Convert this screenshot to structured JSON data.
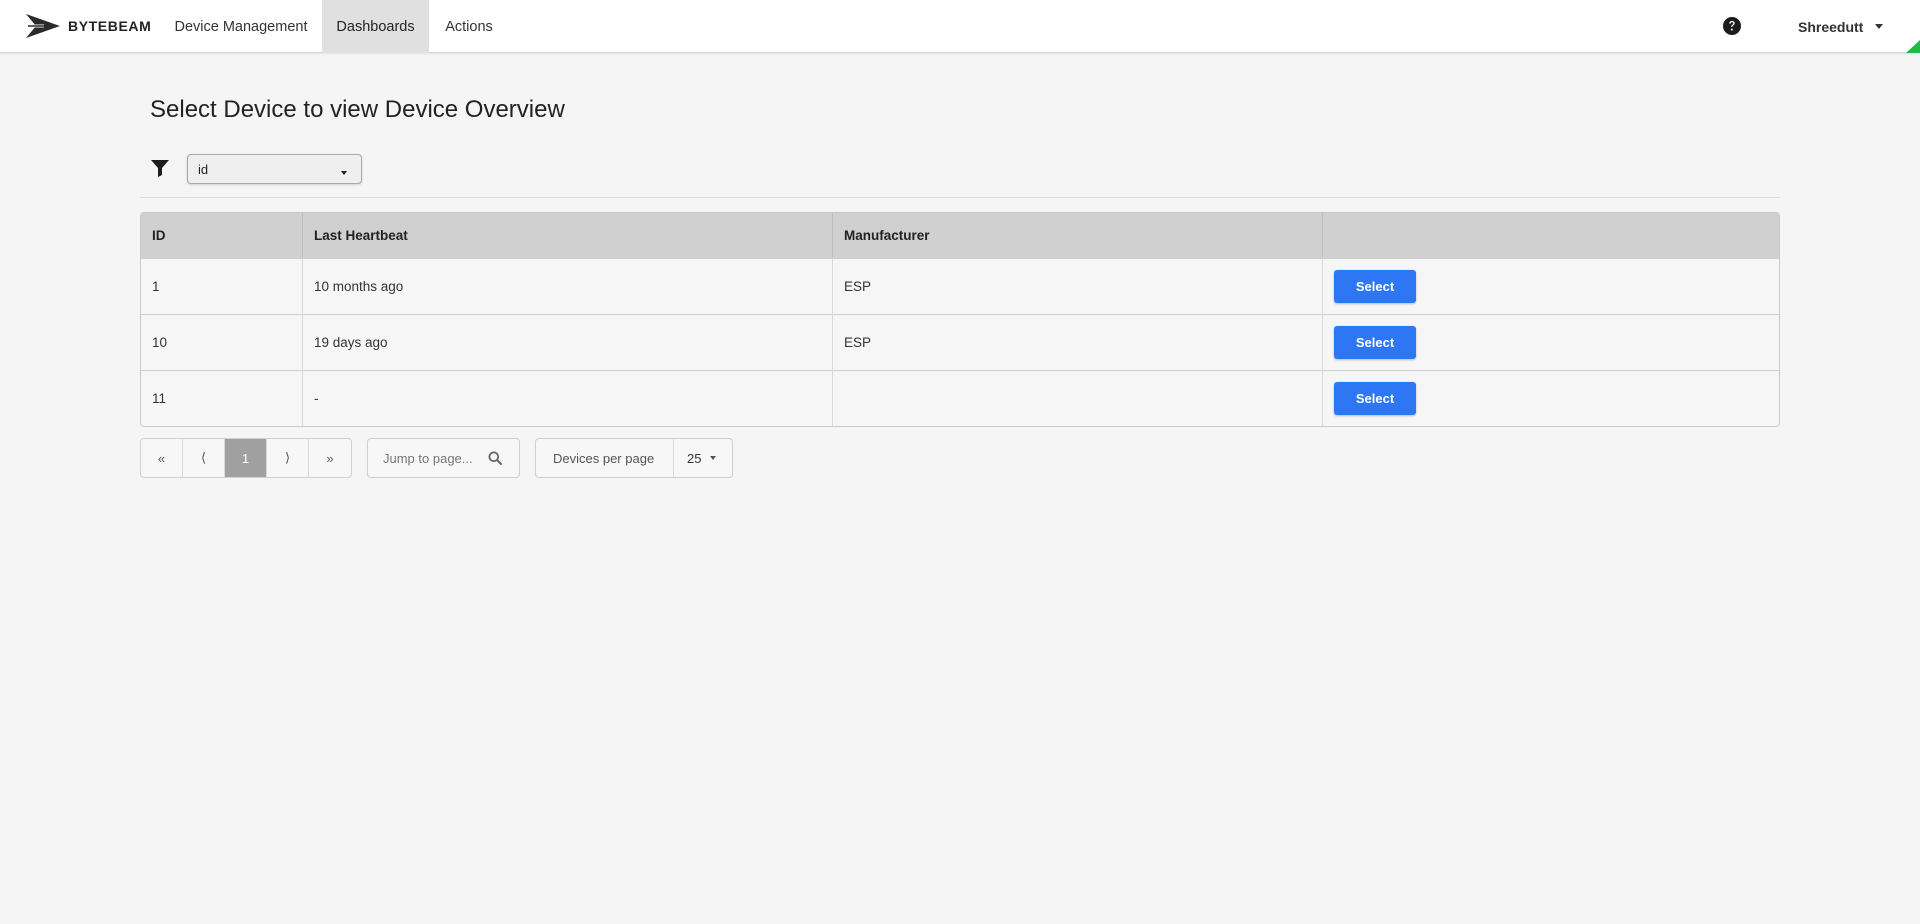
{
  "navbar": {
    "brand": "BYTEBEAM",
    "items": [
      {
        "label": "Device Management",
        "active": false
      },
      {
        "label": "Dashboards",
        "active": true
      },
      {
        "label": "Actions",
        "active": false
      }
    ],
    "help_icon": "question-circle-icon",
    "user": "Shreedutt"
  },
  "page": {
    "title": "Select Device to view Device Overview"
  },
  "filter": {
    "icon": "filter-icon",
    "selected": "id"
  },
  "table": {
    "headers": [
      "ID",
      "Last Heartbeat",
      "Manufacturer",
      ""
    ],
    "rows": [
      {
        "id": "1",
        "last_heartbeat": "10 months ago",
        "manufacturer": "ESP",
        "action": "Select"
      },
      {
        "id": "10",
        "last_heartbeat": "19 days ago",
        "manufacturer": "ESP",
        "action": "Select"
      },
      {
        "id": "11",
        "last_heartbeat": "-",
        "manufacturer": "",
        "action": "Select"
      }
    ]
  },
  "pagination": {
    "first": "«",
    "prev": "⟨",
    "current": "1",
    "next": "⟩",
    "last": "»",
    "jump_placeholder": "Jump to page...",
    "per_page_label": "Devices per page",
    "per_page_value": "25"
  },
  "colors": {
    "primary_button": "#2d77f5",
    "active_nav": "#e0e0e0",
    "active_page": "#a0a0a0"
  }
}
